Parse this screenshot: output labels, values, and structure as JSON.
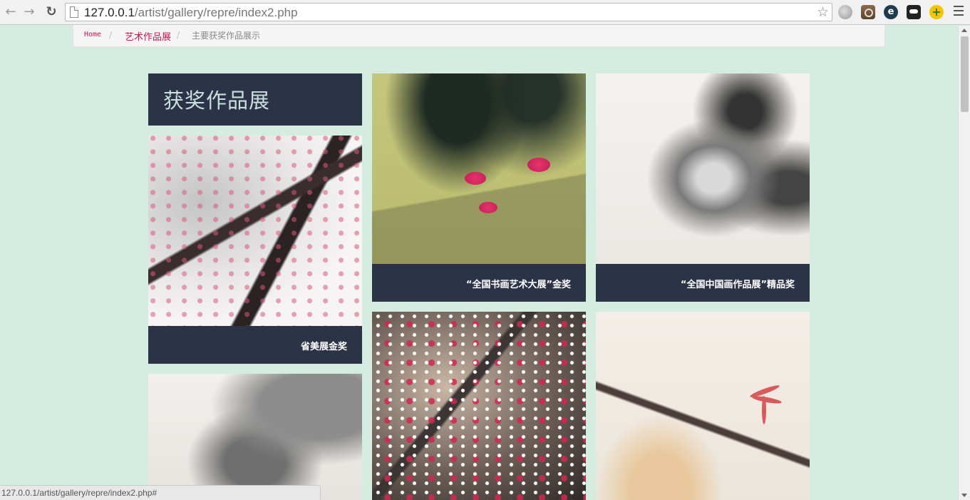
{
  "browser": {
    "url_host": "127.0.0.1",
    "url_path": "/artist/gallery/repre/index2.php",
    "extensions": [
      "globe-icon",
      "camera-icon",
      "e-icon",
      "ghost-icon",
      "plus-icon"
    ]
  },
  "breadcrumb": {
    "home": "Home",
    "separator": "/",
    "category": "艺术作品展",
    "current": "主要获奖作品展示"
  },
  "gallery": {
    "title": "获奖作品展",
    "items": [
      {
        "caption": "省美展金奖"
      },
      {
        "caption": "“全国书画艺术大展”金奖"
      },
      {
        "caption": "“全国中国画作品展”精品奖"
      },
      {
        "caption": ""
      },
      {
        "caption": ""
      },
      {
        "caption": ""
      }
    ]
  },
  "status_bar": {
    "text": "127.0.0.1/artist/gallery/repre/index2.php#"
  },
  "colors": {
    "page_background": "#d4ede0",
    "panel_dark": "#2d3347",
    "link_accent": "#c5134c",
    "title_text": "#c9e0dd"
  }
}
